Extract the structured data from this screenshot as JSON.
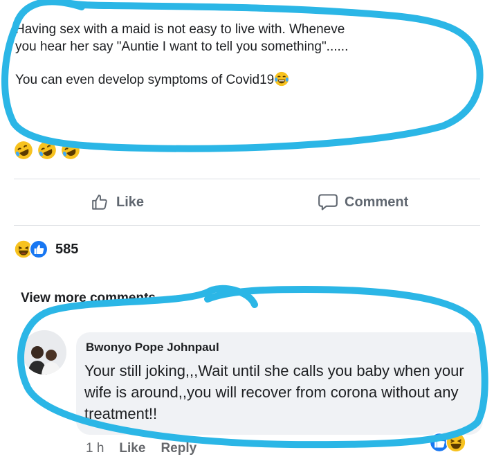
{
  "post": {
    "line1": "Having sex with a maid is not easy to live with. Wheneve",
    "line1b": "you hear her say \"Auntie I want to tell you something\"......",
    "line2": "You can even develop symptoms of Covid19",
    "inline_emoji": "laughing-tears-emoji"
  },
  "reactions_top": [
    "rolling-laughing-emoji",
    "rolling-laughing-emoji",
    "rolling-laughing-emoji"
  ],
  "actions": {
    "like_label": "Like",
    "comment_label": "Comment"
  },
  "reaction_summary": {
    "icons": [
      "laughing-emoji",
      "like-thumb-icon"
    ],
    "count": "585"
  },
  "comments": {
    "view_more_label": "View more comments...",
    "item": {
      "author": "Bwonyo Pope Johnpaul",
      "text": "Your still joking,,,Wait until she calls you baby when your wife is around,,you will recover from corona without any treatment!!",
      "time": "1 h",
      "like_label": "Like",
      "reply_label": "Reply",
      "reactions": [
        "like-thumb-icon",
        "laughing-emoji"
      ]
    }
  },
  "colors": {
    "scribble": "#2bb6e6",
    "like_blue": "#1877f2",
    "emoji_yellow": "#f7c21f",
    "muted_text": "#606770",
    "bubble_bg": "#f0f2f5"
  }
}
